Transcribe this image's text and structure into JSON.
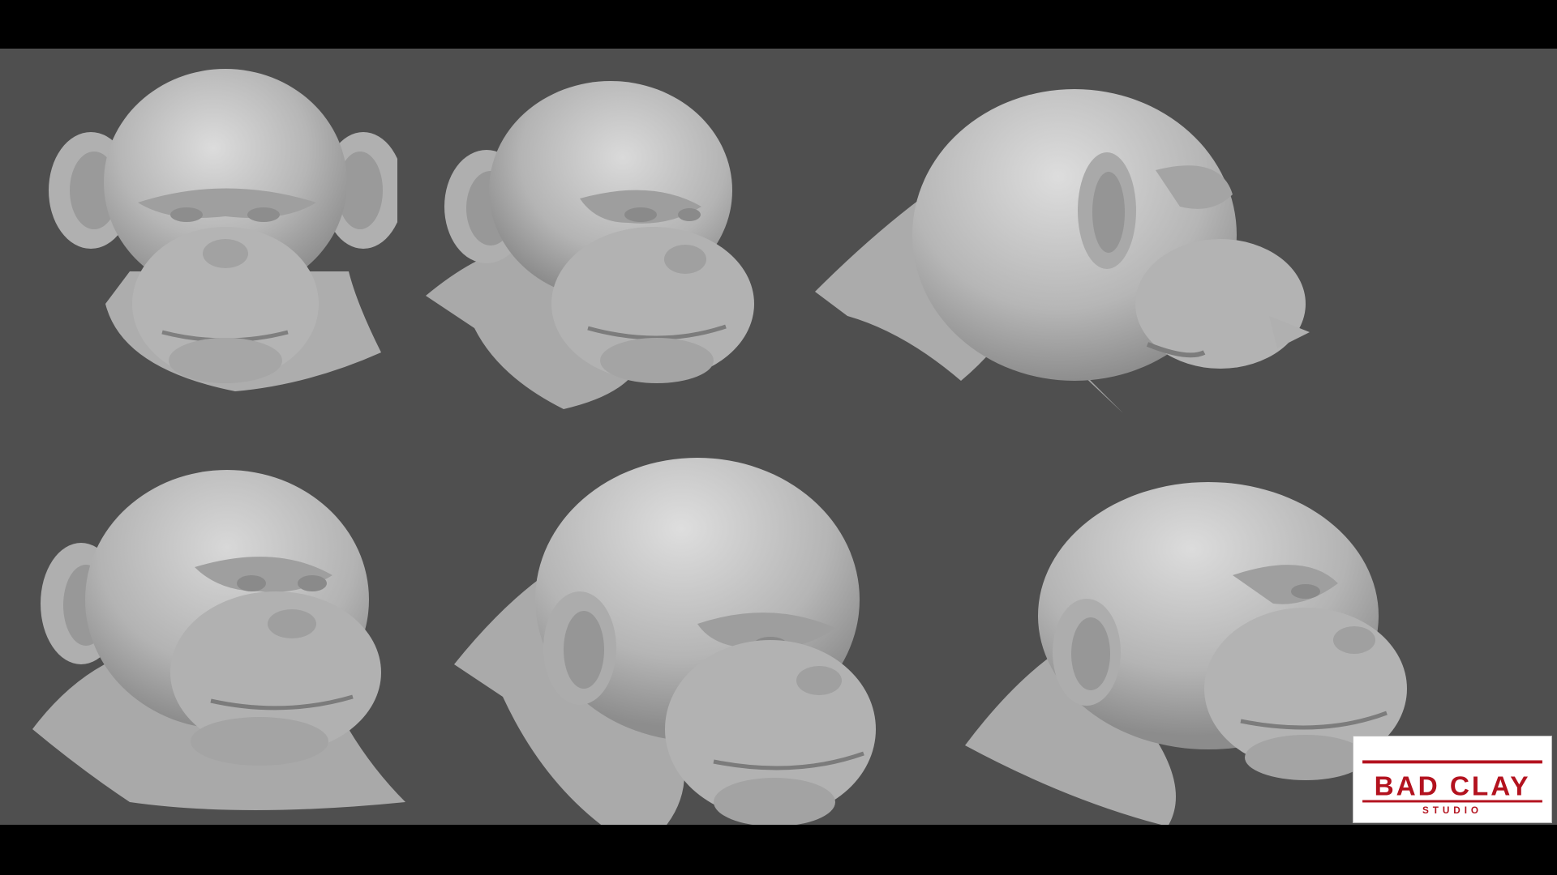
{
  "scene": {
    "background": "#4f4f4f",
    "letterbox": "#000000",
    "sculpt_color": "#b9b9b9"
  },
  "renders": [
    {
      "view": "front"
    },
    {
      "view": "three-quarter-left"
    },
    {
      "view": "profile-right"
    },
    {
      "view": "low-angle-left"
    },
    {
      "view": "three-quarter-right"
    },
    {
      "view": "three-quarter-right-raised"
    }
  ],
  "logo": {
    "text_line1": "BAD CLAY",
    "text_line2": "STUDIO",
    "accent": "#b3121e"
  }
}
